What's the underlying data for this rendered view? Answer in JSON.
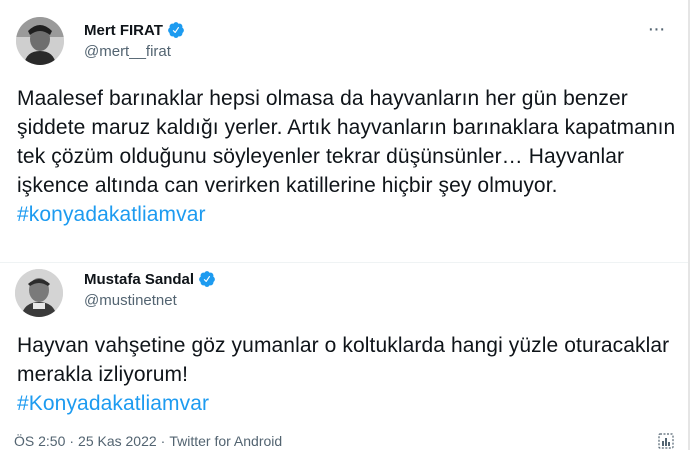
{
  "tweets": [
    {
      "display_name": "Mert FIRAT",
      "handle": "@mert__firat",
      "more_icon": "more-horizontal-icon",
      "text": "Maalesef barınaklar hepsi olmasa da hayvanların her gün benzer şiddete maruz kaldığı yerler. Artık hayvanların barınaklara kapatmanın tek çözüm olduğunu söyleyenler tekrar düşünsünler… Hayvanlar işkence altında can verirken katillerine hiçbir şey olmuyor. ",
      "hashtag": "#konyadakatliamvar"
    },
    {
      "display_name": "Mustafa Sandal",
      "handle": "@mustinetnet",
      "text": "Hayvan vahşetine göz yumanlar o koltuklarda hangi yüzle oturacaklar merakla izliyorum!",
      "hashtag": "#Konyadakatliamvar"
    }
  ],
  "meta": {
    "time": "ÖS 2:50",
    "date": "25 Kas 2022",
    "separator": "·",
    "source": "Twitter for Android"
  },
  "colors": {
    "text": "#0f1419",
    "secondary": "#536471",
    "link": "#1d9bf0",
    "verified": "#1d9bf0"
  },
  "icons": [
    "verified-badge-icon",
    "more-horizontal-icon",
    "analytics-icon"
  ]
}
